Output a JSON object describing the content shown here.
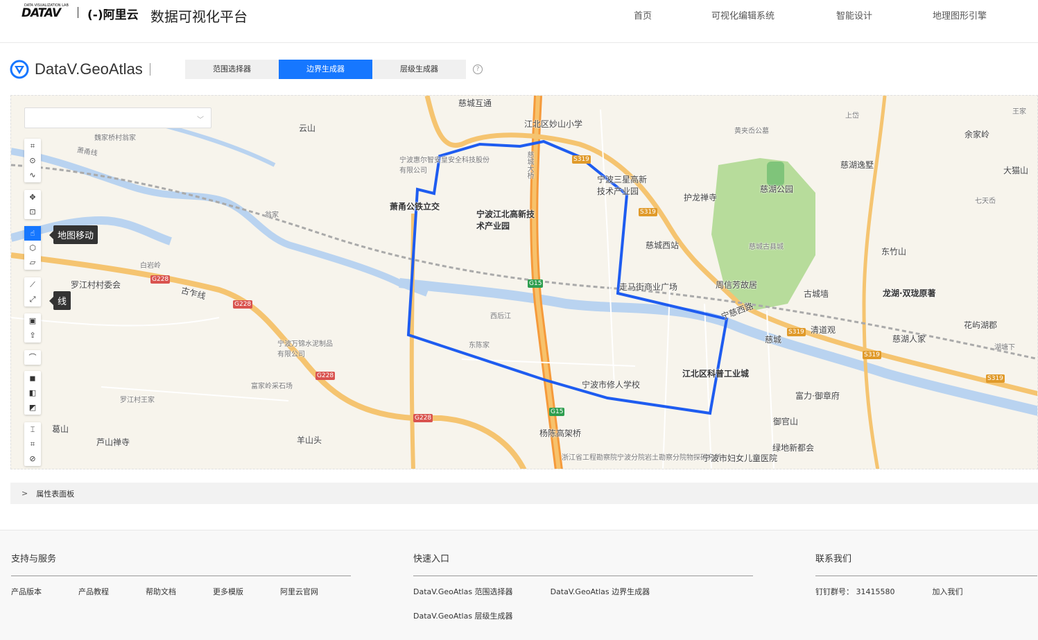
{
  "topnav": {
    "logo_lab": "DATA VISUALIZATION LAB",
    "logo_datav": "DATAV",
    "logo_aliyun": "(-)阿里云",
    "platform_title": "数据可视化平台",
    "items": [
      "首页",
      "可视化编辑系统",
      "智能设计",
      "地理图形引擎"
    ]
  },
  "brand": {
    "name": "DataV.GeoAtlas"
  },
  "tabs": [
    {
      "label": "范围选择器",
      "active": false
    },
    {
      "label": "边界生成器",
      "active": true
    },
    {
      "label": "层级生成器",
      "active": false
    }
  ],
  "help": "?",
  "region_select": {
    "value": ""
  },
  "toolbar": {
    "tooltips": {
      "map_move": "地图移动",
      "line": "线"
    }
  },
  "map": {
    "labels": [
      "慈城互通",
      "江北区妙山小学",
      "云山",
      "魏家桥村翁家",
      "宁波惠尔智安皇安全科技股份有限公司",
      "宁波三星高新技术产业园",
      "黄夹岙公墓",
      "慈湖逸墅",
      "余家岭",
      "王家",
      "大猫山",
      "慈湖公园",
      "护龙禅寺",
      "萧甬公铁立交",
      "宁波江北高新技术产业园",
      "慈城西站",
      "慈城古县城",
      "东竹山",
      "龙湖·双珑原著",
      "罗江村村委会",
      "走马街商业广场",
      "周信芳故居",
      "古城墙",
      "清道观",
      "慈城",
      "慈湖人家",
      "花屿湖郡",
      "宁波万锦水泥制品有限公司",
      "江北区科普工业城",
      "宁波市修人学校",
      "富力·御章府",
      "御官山",
      "葛山",
      "芦山禅寺",
      "羊山头",
      "杨陈高架桥",
      "浙江省工程勘察院宁波分院岩土勘察分院物探研究所",
      "宁波市妇女儿童医院",
      "绿地新都会",
      "富家岭采石场",
      "宁慈西路",
      "古乍线",
      "萧甬线",
      "湖塘下",
      "七天岙",
      "上岱",
      "罗江村王家",
      "慈城大桥",
      "西后江",
      "东陈家",
      "白岩岭",
      "翁家"
    ],
    "shields": [
      "G228",
      "G228",
      "G228",
      "G228",
      "G15",
      "G15",
      "S319",
      "S319",
      "S319",
      "S319",
      "S319"
    ]
  },
  "props_panel": {
    "arrow": ">",
    "label": "属性表面板"
  },
  "footer": {
    "support": {
      "title": "支持与服务",
      "links": [
        "产品版本",
        "产品教程",
        "帮助文档",
        "更多模版",
        "阿里云官网"
      ]
    },
    "quick": {
      "title": "快速入口",
      "links": [
        "DataV.GeoAtlas 范围选择器",
        "DataV.GeoAtlas 边界生成器",
        "DataV.GeoAtlas 层级生成器"
      ]
    },
    "contact": {
      "title": "联系我们",
      "links": [
        "钉钉群号：  31415580",
        "加入我们"
      ]
    }
  }
}
